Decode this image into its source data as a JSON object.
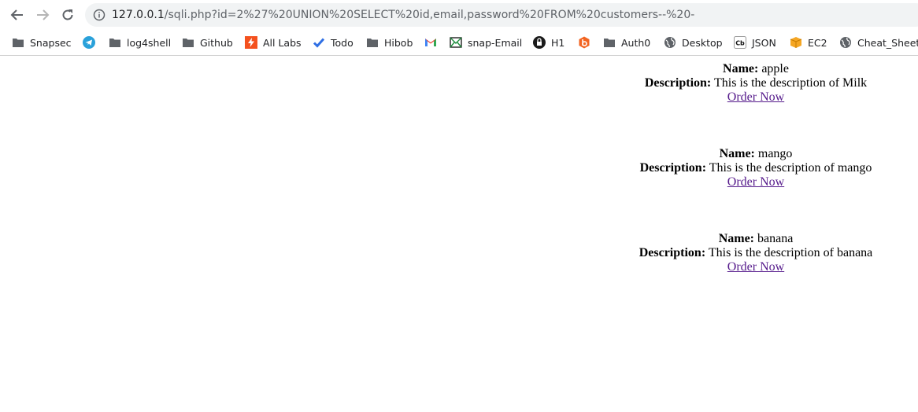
{
  "browser": {
    "url": {
      "host": "127.0.0.1",
      "path": "/sqli.php?id=2%27%20UNION%20SELECT%20id,email,password%20FROM%20customers--%20-"
    },
    "bookmarks": [
      {
        "label": "Snapsec",
        "icon": "folder-icon"
      },
      {
        "label": "",
        "icon": "telegram-icon"
      },
      {
        "label": "log4shell",
        "icon": "folder-icon"
      },
      {
        "label": "Github",
        "icon": "folder-icon"
      },
      {
        "label": "All Labs",
        "icon": "bolt-icon"
      },
      {
        "label": "Todo",
        "icon": "check-icon"
      },
      {
        "label": "Hibob",
        "icon": "folder-icon"
      },
      {
        "label": "",
        "icon": "gmail-icon"
      },
      {
        "label": "snap-Email",
        "icon": "mail-icon"
      },
      {
        "label": "H1",
        "icon": "h1-icon"
      },
      {
        "label": "",
        "icon": "b-badge-icon"
      },
      {
        "label": "Auth0",
        "icon": "folder-icon"
      },
      {
        "label": "Desktop",
        "icon": "globe-icon"
      },
      {
        "label": "JSON",
        "icon": "cb-icon"
      },
      {
        "label": "EC2",
        "icon": "box-icon"
      },
      {
        "label": "Cheat_Sheet",
        "icon": "globe-icon"
      }
    ]
  },
  "page": {
    "name_label": "Name:",
    "description_label": "Description:",
    "products": [
      {
        "name": "apple",
        "description": "This is the description of Milk",
        "order_label": "Order Now"
      },
      {
        "name": "mango",
        "description": "This is the description of mango",
        "order_label": "Order Now"
      },
      {
        "name": "banana",
        "description": "This is the description of banana",
        "order_label": "Order Now"
      }
    ]
  }
}
